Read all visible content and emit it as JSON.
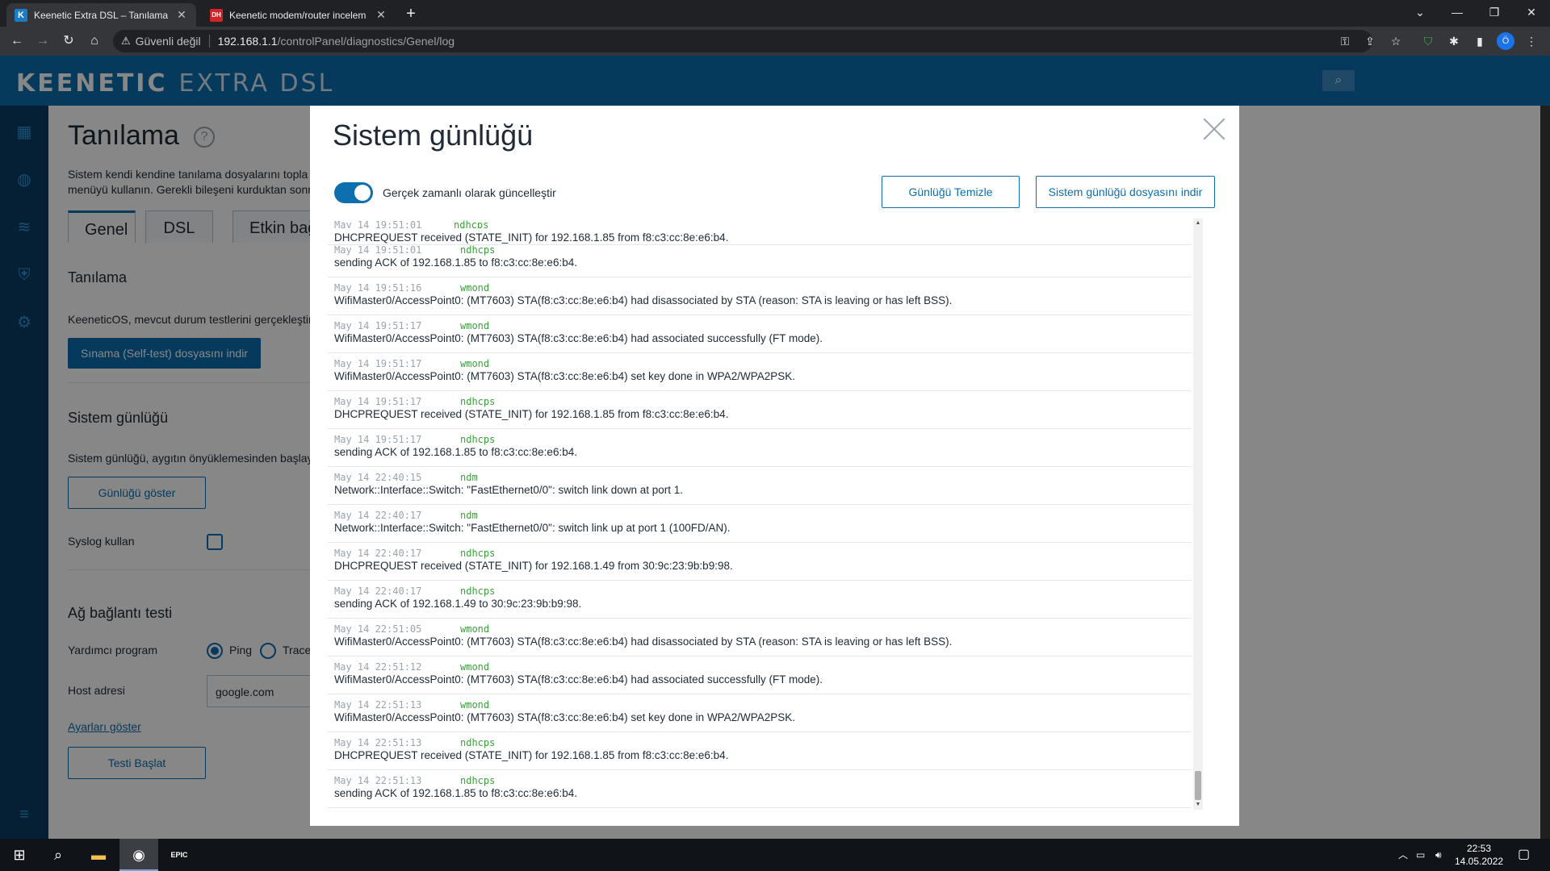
{
  "browser": {
    "tabs": [
      {
        "title": "Keenetic Extra DSL – Tanılama",
        "favicon": "K"
      },
      {
        "title": "Keenetic modem/router incelem",
        "favicon": "DH"
      }
    ],
    "address": {
      "security_label": "Güvenli değil",
      "host": "192.168.1.1",
      "path": "/controlPanel/diagnostics/Genel/log"
    },
    "profile_initial": "Ö"
  },
  "app": {
    "brand_main": "KEENETIC",
    "brand_model": "EXTRA DSL"
  },
  "page": {
    "title": "Tanılama",
    "intro_line1": "Sistem kendi kendine tanılama dosyalarını topla",
    "intro_line2": "menüyü kullanın. Gerekli bileşeni kurduktan sonr",
    "tabs": [
      "Genel",
      "DSL",
      "Etkin bağ"
    ],
    "diag_section_title": "Tanılama",
    "diag_text": "KeeneticOS, mevcut durum testlerini gerçekleştir",
    "selftest_button": "Sınama (Self-test) dosyasını indir",
    "log_section_title": "Sistem günlüğü",
    "log_text": "Sistem günlüğü, aygıtın önyüklemesinden başlay",
    "show_log_button": "Günlüğü göster",
    "syslog_label": "Syslog kullan",
    "net_section_title": "Ağ bağlantı testi",
    "helper_label": "Yardımcı program",
    "helper_options": [
      "Ping",
      "Trace"
    ],
    "host_label": "Host adresi",
    "host_value": "google.com",
    "settings_link": "Ayarları göster",
    "start_test_button": "Testi Başlat"
  },
  "modal": {
    "title": "Sistem günlüğü",
    "realtime_label": "Gerçek zamanlı olarak güncelleştir",
    "realtime_on": true,
    "clear_button": "Günlüğü Temizle",
    "download_button": "Sistem günlüğü dosyasını indir",
    "cut_entry": {
      "time": "May 14 19:51:01",
      "proc": "ndhcps"
    },
    "log_entries": [
      {
        "time": "",
        "proc": "",
        "msg": "DHCPREQUEST received (STATE_INIT) for 192.168.1.85 from f8:c3:cc:8e:e6:b4."
      },
      {
        "time": "May 14 19:51:01",
        "proc": "ndhcps",
        "msg": "sending ACK of 192.168.1.85 to f8:c3:cc:8e:e6:b4."
      },
      {
        "time": "May 14 19:51:16",
        "proc": "wmond",
        "msg": "WifiMaster0/AccessPoint0: (MT7603) STA(f8:c3:cc:8e:e6:b4) had disassociated by STA (reason: STA is leaving or has left BSS)."
      },
      {
        "time": "May 14 19:51:17",
        "proc": "wmond",
        "msg": "WifiMaster0/AccessPoint0: (MT7603) STA(f8:c3:cc:8e:e6:b4) had associated successfully (FT mode)."
      },
      {
        "time": "May 14 19:51:17",
        "proc": "wmond",
        "msg": "WifiMaster0/AccessPoint0: (MT7603) STA(f8:c3:cc:8e:e6:b4) set key done in WPA2/WPA2PSK."
      },
      {
        "time": "May 14 19:51:17",
        "proc": "ndhcps",
        "msg": "DHCPREQUEST received (STATE_INIT) for 192.168.1.85 from f8:c3:cc:8e:e6:b4."
      },
      {
        "time": "May 14 19:51:17",
        "proc": "ndhcps",
        "msg": "sending ACK of 192.168.1.85 to f8:c3:cc:8e:e6:b4."
      },
      {
        "time": "May 14 22:40:15",
        "proc": "ndm",
        "msg": "Network::Interface::Switch: \"FastEthernet0/0\": switch link down at port 1."
      },
      {
        "time": "May 14 22:40:17",
        "proc": "ndm",
        "msg": "Network::Interface::Switch: \"FastEthernet0/0\": switch link up at port 1 (100FD/AN)."
      },
      {
        "time": "May 14 22:40:17",
        "proc": "ndhcps",
        "msg": "DHCPREQUEST received (STATE_INIT) for 192.168.1.49 from 30:9c:23:9b:b9:98."
      },
      {
        "time": "May 14 22:40:17",
        "proc": "ndhcps",
        "msg": "sending ACK of 192.168.1.49 to 30:9c:23:9b:b9:98."
      },
      {
        "time": "May 14 22:51:05",
        "proc": "wmond",
        "msg": "WifiMaster0/AccessPoint0: (MT7603) STA(f8:c3:cc:8e:e6:b4) had disassociated by STA (reason: STA is leaving or has left BSS)."
      },
      {
        "time": "May 14 22:51:12",
        "proc": "wmond",
        "msg": "WifiMaster0/AccessPoint0: (MT7603) STA(f8:c3:cc:8e:e6:b4) had associated successfully (FT mode)."
      },
      {
        "time": "May 14 22:51:13",
        "proc": "wmond",
        "msg": "WifiMaster0/AccessPoint0: (MT7603) STA(f8:c3:cc:8e:e6:b4) set key done in WPA2/WPA2PSK."
      },
      {
        "time": "May 14 22:51:13",
        "proc": "ndhcps",
        "msg": "DHCPREQUEST received (STATE_INIT) for 192.168.1.85 from f8:c3:cc:8e:e6:b4."
      },
      {
        "time": "May 14 22:51:13",
        "proc": "ndhcps",
        "msg": "sending ACK of 192.168.1.85 to f8:c3:cc:8e:e6:b4."
      }
    ]
  },
  "taskbar": {
    "time": "22:53",
    "date": "14.05.2022",
    "epic_label": "EPIC"
  },
  "colors": {
    "brand_blue": "#0d6fae",
    "nav_dark": "#0b3d63",
    "proc_green": "#3aa23a"
  }
}
